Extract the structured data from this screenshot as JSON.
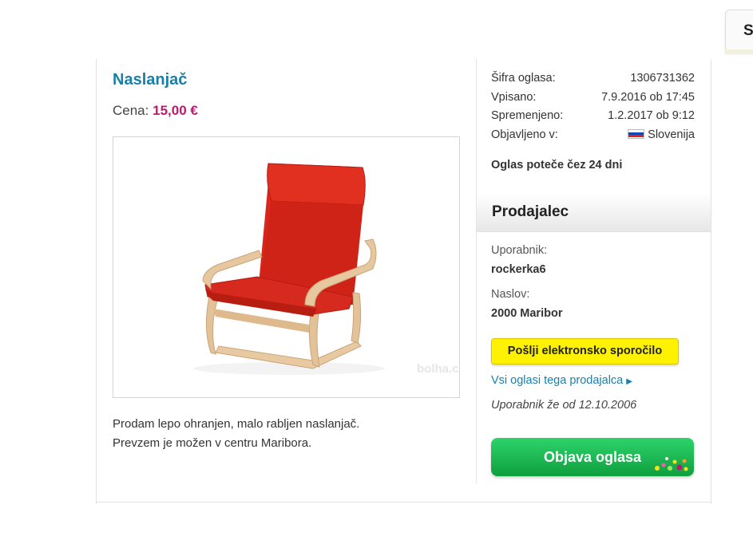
{
  "corner_tab": {
    "label": "S"
  },
  "listing": {
    "title": "Naslanjač",
    "price_label": "Cena:",
    "price_value": "15,00 €",
    "image_watermark": "bolha.com",
    "description_lines": [
      "Prodam lepo ohranjen, malo rabljen naslanjač.",
      "Prevzem je možen v centru Maribora."
    ]
  },
  "meta": {
    "rows": [
      {
        "label": "Šifra oglasa:",
        "value": "1306731362"
      },
      {
        "label": "Vpisano:",
        "value": "7.9.2016 ob 17:45"
      },
      {
        "label": "Spremenjeno:",
        "value": "1.2.2017 ob 9:12"
      },
      {
        "label": "Objavljeno v:",
        "value": "Slovenija"
      }
    ],
    "expires": "Oglas poteče čez 24 dni"
  },
  "seller": {
    "header": "Prodajalec",
    "user_label": "Uporabnik:",
    "user_value": "rockerka6",
    "address_label": "Naslov:",
    "address_value": "2000 Maribor",
    "message_button": "Pošlji elektronsko sporočilo",
    "all_ads_link": "Vsi oglasi tega prodajalca",
    "member_since": "Uporabnik že od 12.10.2006"
  },
  "post_button": "Objava oglasa",
  "colors": {
    "title": "#1a7fa8",
    "price": "#c0186f",
    "message_button": "#fff200",
    "post_button": "#17b24f"
  }
}
